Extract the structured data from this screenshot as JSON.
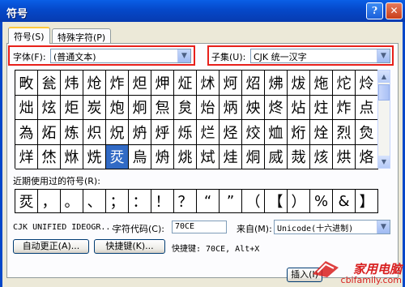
{
  "window": {
    "title": "符号",
    "help_icon": "help-icon",
    "close_icon": "close-icon"
  },
  "tabs": [
    {
      "label": "符号(S)"
    },
    {
      "label": "特殊字符(P)"
    }
  ],
  "font": {
    "label": "字体(F):",
    "value": "(普通文本)"
  },
  "subset": {
    "label": "子集(U):",
    "value": "CJK 统一汉字"
  },
  "symbol_grid": [
    [
      "畋",
      "瓮",
      "炜",
      "炝",
      "炸",
      "炟",
      "炠",
      "炡",
      "炢",
      "炣",
      "炤",
      "炥",
      "炦",
      "炧",
      "炨",
      "炩"
    ],
    [
      "炪",
      "炫",
      "炬",
      "炭",
      "炮",
      "炯",
      "炰",
      "炱",
      "炲",
      "炳",
      "炴",
      "炵",
      "炶",
      "炷",
      "炸",
      "点"
    ],
    [
      "為",
      "炻",
      "炼",
      "炽",
      "炾",
      "炿",
      "烀",
      "烁",
      "烂",
      "烃",
      "烄",
      "烅",
      "烆",
      "烇",
      "烈",
      "烉"
    ],
    [
      "烊",
      "烋",
      "烌",
      "烍",
      "烎",
      "烏",
      "烐",
      "烑",
      "烒",
      "烓",
      "烔",
      "烕",
      "烖",
      "烗",
      "烘",
      "烙"
    ]
  ],
  "selected_cell": {
    "row": 3,
    "col": 4
  },
  "recent": {
    "label": "近期使用过的符号(R):",
    "symbols": [
      "烎",
      "，",
      "。",
      "、",
      "；",
      "：",
      "！",
      "？",
      "“",
      "”",
      "（",
      "【",
      "）",
      "%",
      "&",
      "】"
    ]
  },
  "char_info": {
    "name": "CJK UNIFIED IDEOGR...",
    "code_label": "字符代码(C):",
    "code_value": "70CE",
    "from_label": "来自(M):",
    "from_value": "Unicode(十六进制)"
  },
  "buttons": {
    "autocorrect": "自动更正(A)...",
    "shortcut_key": "快捷键(K)...",
    "shortcut_text": "快捷键: 70CE, Alt+X",
    "insert": "插入(I)"
  },
  "watermark": {
    "line1": "家用电脑",
    "line2": "cbifamily.com"
  },
  "colors": {
    "titlebar": "#0548c9",
    "highlight_box": "#e8201a",
    "selection": "#316ac5"
  }
}
